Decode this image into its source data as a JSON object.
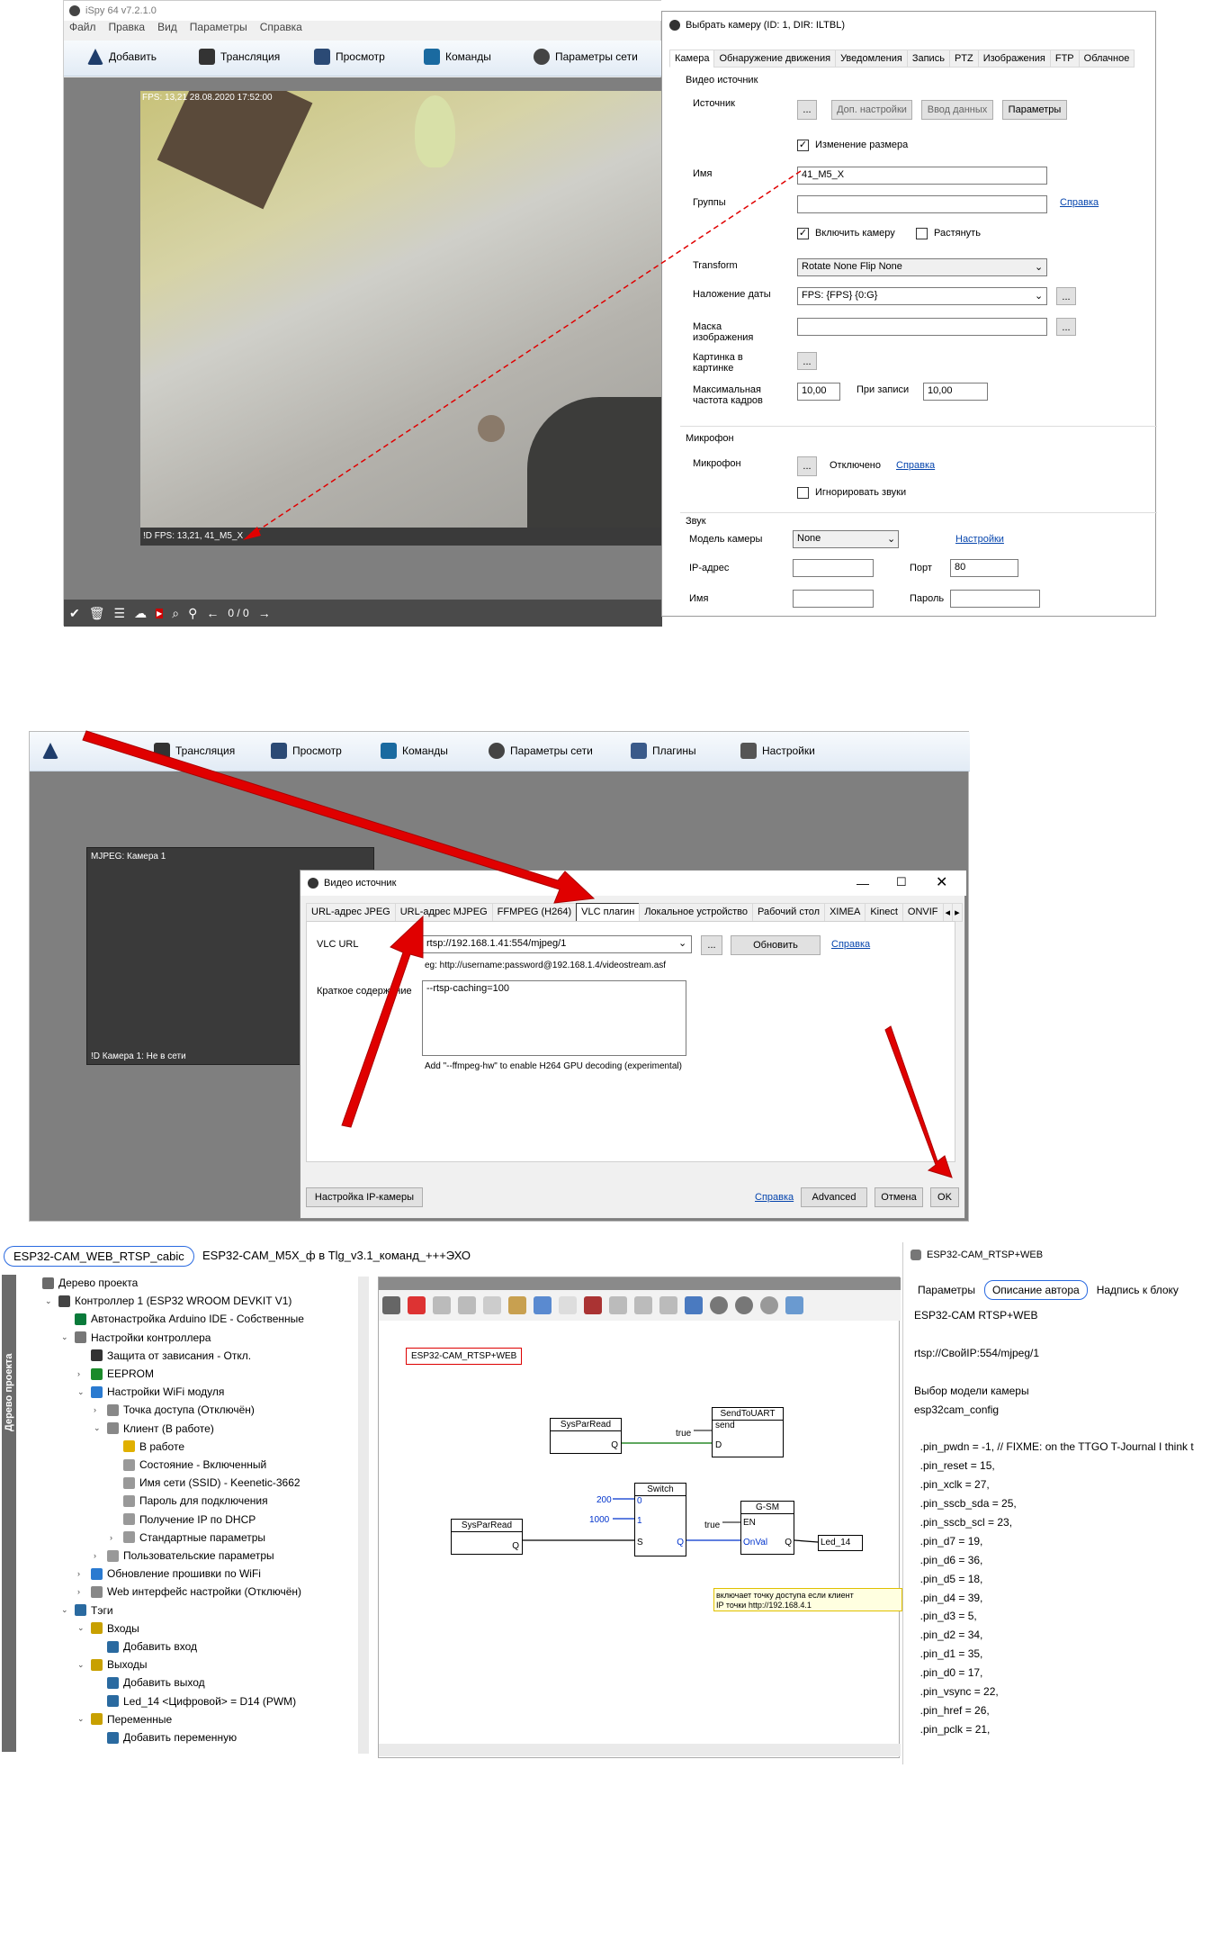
{
  "s1": {
    "title": "iSpy 64 v7.2.1.0",
    "menu": [
      "Файл",
      "Правка",
      "Вид",
      "Параметры",
      "Справка"
    ],
    "toolbar": [
      "Добавить",
      "Трансляция",
      "Просмотр",
      "Команды",
      "Параметры сети"
    ],
    "overlay_top": "FPS: 13,21 28.08.2020 17:52:00",
    "overlay_bottom": "!D  FPS: 13,21, 41_M5_X",
    "counter": "0 / 0"
  },
  "cam": {
    "title": "Выбрать камеру (ID: 1, DIR: ILTBL)",
    "tabs": [
      "Камера",
      "Обнаружение движения",
      "Уведомления",
      "Запись",
      "PTZ",
      "Изображения",
      "FTP",
      "Облачное"
    ],
    "section_video": "Видео источник",
    "source_label": "Источник",
    "btn_dots": "...",
    "btn_dop": "Доп. настройки",
    "btn_vvod": "Ввод данных",
    "btn_params": "Параметры",
    "resize_label": "Изменение размера",
    "name_label": "Имя",
    "name_value": "41_M5_X",
    "groups_label": "Группы",
    "help": "Справка",
    "enable_label": "Включить камеру",
    "stretch_label": "Растянуть",
    "transform_label": "Transform",
    "transform_value": "Rotate None Flip None",
    "date_label": "Наложение даты",
    "date_value": "FPS: {FPS} {0:G}",
    "mask_label": "Маска изображения",
    "pip_label": "Картинка в картинке",
    "maxfps_label": "Максимальная частота кадров",
    "maxfps_value": "10,00",
    "rec_label": "При записи",
    "rec_value": "10,00",
    "section_mic": "Микрофон",
    "mic_label": "Микрофон",
    "mic_status": "Отключено",
    "ignore_label": "Игнорировать звуки",
    "section_sound": "Звук",
    "model_label": "Модель камеры",
    "model_value": "None",
    "settings_link": "Настройки",
    "ip_label": "IP-адрес",
    "port_label": "Порт",
    "port_value": "80",
    "user_label": "Имя",
    "pass_label": "Пароль"
  },
  "s2": {
    "toolbar": [
      "Трансляция",
      "Просмотр",
      "Команды",
      "Параметры сети",
      "Плагины",
      "Настройки"
    ],
    "tile_top": "MJPEG: Камера 1",
    "tile_bottom": "!D  Камера 1: Не в сети"
  },
  "vs": {
    "title": "Видео источник",
    "tabs": [
      "URL-адрес JPEG",
      "URL-адрес MJPEG",
      "FFMPEG (H264)",
      "VLC плагин",
      "Локальное устройство",
      "Рабочий стол",
      "XIMEA",
      "Kinect",
      "ONVIF"
    ],
    "vlc_label": "VLC URL",
    "vlc_value": "rtsp://192.168.1.41:554/mjpeg/1",
    "btn_dots": "...",
    "btn_refresh": "Обновить",
    "help": "Справка",
    "example": "eg: http://username:password@192.168.1.4/videostream.asf",
    "summary_label": "Краткое содержание",
    "summary_value": "--rtsp-caching=100",
    "hint": "Add \"--ffmpeg-hw\" to enable H264 GPU decoding (experimental)",
    "btn_ipcam": "Настройка IP-камеры",
    "btn_advanced": "Advanced",
    "btn_cancel": "Отмена",
    "btn_ok": "OK"
  },
  "s3": {
    "tab1": "ESP32-CAM_WEB_RTSP_cabic",
    "tab2": "ESP32-CAM_M5X_ф в Tlg_v3.1_команд_+++ЭХО",
    "side_label": "Дерево проекта",
    "tree": [
      {
        "t": "Дерево проекта",
        "l": 0,
        "a": "",
        "c": "#6a6a6a"
      },
      {
        "t": "Контроллер 1 (ESP32 WROOM DEVKIT V1)",
        "l": 1,
        "a": "v",
        "c": "#444"
      },
      {
        "t": "Автонастройка Arduino IDE - Собственные",
        "l": 2,
        "a": "",
        "c": "#0a7a3a"
      },
      {
        "t": "Настройки контроллера",
        "l": 2,
        "a": "v",
        "c": "#777"
      },
      {
        "t": "Защита от зависания - Откл.",
        "l": 3,
        "a": "",
        "c": "#333"
      },
      {
        "t": "EEPROM",
        "l": 3,
        "a": ">",
        "c": "#1a8a2a"
      },
      {
        "t": "Настройки WiFi модуля",
        "l": 3,
        "a": "v",
        "c": "#2a7ad0"
      },
      {
        "t": "Точка доступа (Отключён)",
        "l": 4,
        "a": ">",
        "c": "#888"
      },
      {
        "t": "Клиент (В работе)",
        "l": 4,
        "a": "v",
        "c": "#888"
      },
      {
        "t": "В работе",
        "l": 5,
        "a": "",
        "c": "#e0b000"
      },
      {
        "t": "Состояние - Включенный",
        "l": 5,
        "a": "",
        "c": "#999"
      },
      {
        "t": "Имя сети (SSID) - Keenetic-3662",
        "l": 5,
        "a": "",
        "c": "#999"
      },
      {
        "t": "Пароль для подключения",
        "l": 5,
        "a": "",
        "c": "#999"
      },
      {
        "t": "Получение IP по DHCP",
        "l": 5,
        "a": "",
        "c": "#999"
      },
      {
        "t": "Стандартные параметры",
        "l": 5,
        "a": ">",
        "c": "#999"
      },
      {
        "t": "Пользовательские параметры",
        "l": 4,
        "a": ">",
        "c": "#999"
      },
      {
        "t": "Обновление прошивки по WiFi",
        "l": 3,
        "a": ">",
        "c": "#2a7ad0"
      },
      {
        "t": "Web интерфейс настройки (Отключён)",
        "l": 3,
        "a": ">",
        "c": "#888"
      },
      {
        "t": "Тэги",
        "l": 2,
        "a": "v",
        "c": "#2a6aa0"
      },
      {
        "t": "Входы",
        "l": 3,
        "a": "v",
        "c": "#c8a000"
      },
      {
        "t": "Добавить вход",
        "l": 4,
        "a": "",
        "c": "#2a6aa0"
      },
      {
        "t": "Выходы",
        "l": 3,
        "a": "v",
        "c": "#c8a000"
      },
      {
        "t": "Добавить выход",
        "l": 4,
        "a": "",
        "c": "#2a6aa0"
      },
      {
        "t": "Led_14 <Цифровой>  = D14 (PWM)",
        "l": 4,
        "a": "",
        "c": "#2a6aa0"
      },
      {
        "t": "Переменные",
        "l": 3,
        "a": "v",
        "c": "#c8a000"
      },
      {
        "t": "Добавить переменную",
        "l": 4,
        "a": "",
        "c": "#2a6aa0"
      }
    ],
    "canvas_title": "ESP32-CAM_RTSP+WEB",
    "blocks": {
      "sys1": "SysParRead",
      "sys1_out": "Q",
      "send": "SendToUART",
      "send_in": "send",
      "send_d": "D",
      "true1": "true",
      "sw": "Switch",
      "sw_in0": "0",
      "sw_in1": "1",
      "sw_s": "S",
      "sw_q": "Q",
      "c200": "200",
      "c1000": "1000",
      "sys2": "SysParRead",
      "sys2_out": "Q",
      "gsm": "G-SM",
      "gsm_en": "EN",
      "gsm_onval": "OnVal",
      "gsm_q": "Q",
      "true2": "true",
      "led": "Led_14"
    },
    "note1": "включает точку доступа если клиент",
    "note2": "IP точки http://192.168.4.1",
    "right_title": "ESP32-CAM_RTSP+WEB",
    "right_tabs": [
      "Параметры",
      "Описание автора",
      "Надпись к блоку"
    ],
    "right_lines": [
      "ESP32-CAM RTSP+WEB",
      "",
      "rtsp://СвойIP:554/mjpeg/1",
      "",
      "Выбор модели камеры",
      "esp32cam_config",
      "",
      "  .pin_pwdn = -1, // FIXME: on the TTGO T-Journal I think t",
      "  .pin_reset = 15,",
      "  .pin_xclk = 27,",
      "  .pin_sscb_sda = 25,",
      "  .pin_sscb_scl = 23,",
      "  .pin_d7 = 19,",
      "  .pin_d6 = 36,",
      "  .pin_d5 = 18,",
      "  .pin_d4 = 39,",
      "  .pin_d3 = 5,",
      "  .pin_d2 = 34,",
      "  .pin_d1 = 35,",
      "  .pin_d0 = 17,",
      "  .pin_vsync = 22,",
      "  .pin_href = 26,",
      "  .pin_pclk = 21,"
    ]
  },
  "colors": {
    "accent": "#0078d7",
    "arrow": "#e00000",
    "toolbar_bg": "#eef3fa"
  }
}
